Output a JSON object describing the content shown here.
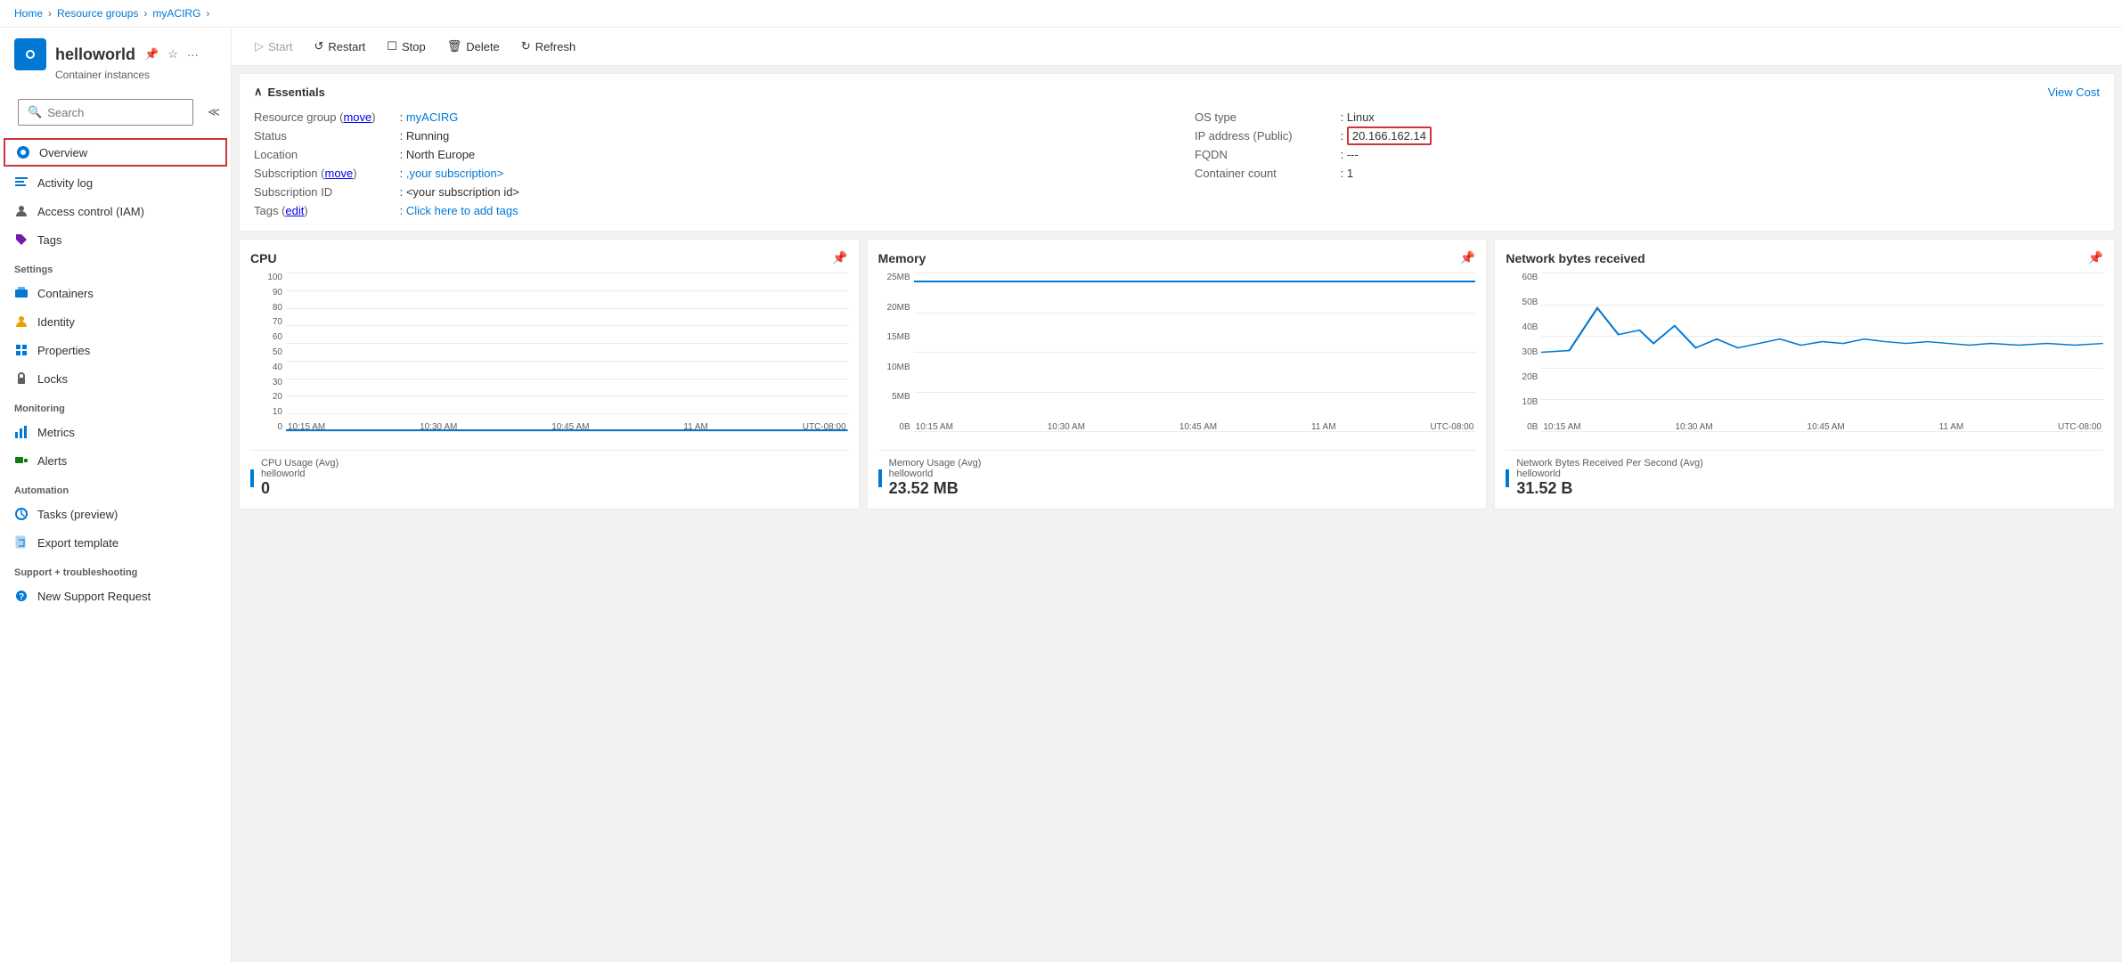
{
  "breadcrumb": {
    "home": "Home",
    "resourceGroups": "Resource groups",
    "myACIRG": "myACIRG"
  },
  "resource": {
    "name": "helloworld",
    "subtitle": "Container instances",
    "icon": "📦"
  },
  "search": {
    "placeholder": "Search"
  },
  "toolbar": {
    "start": "Start",
    "restart": "Restart",
    "stop": "Stop",
    "delete": "Delete",
    "refresh": "Refresh"
  },
  "essentials": {
    "title": "Essentials",
    "viewCost": "View Cost",
    "resourceGroupLabel": "Resource group (move)",
    "resourceGroupValue": "myACIRG",
    "statusLabel": "Status",
    "statusValue": "Running",
    "locationLabel": "Location",
    "locationValue": "North Europe",
    "subscriptionLabel": "Subscription (move)",
    "subscriptionValue": ",your subscription>",
    "subscriptionIdLabel": "Subscription ID",
    "subscriptionIdValue": "<your subscription id>",
    "tagsLabel": "Tags (edit)",
    "tagsValue": "Click here to add tags",
    "osTypeLabel": "OS type",
    "osTypeValue": "Linux",
    "ipAddressLabel": "IP address (Public)",
    "ipAddressValue": "20.166.162.14",
    "fqdnLabel": "FQDN",
    "fqdnValue": "---",
    "containerCountLabel": "Container count",
    "containerCountValue": "1"
  },
  "sidebar": {
    "overview": "Overview",
    "activityLog": "Activity log",
    "accessControl": "Access control (IAM)",
    "tags": "Tags",
    "settingsLabel": "Settings",
    "containers": "Containers",
    "identity": "Identity",
    "properties": "Properties",
    "locks": "Locks",
    "monitoringLabel": "Monitoring",
    "metrics": "Metrics",
    "alerts": "Alerts",
    "automationLabel": "Automation",
    "tasks": "Tasks (preview)",
    "exportTemplate": "Export template",
    "supportLabel": "Support + troubleshooting",
    "newSupportRequest": "New Support Request"
  },
  "charts": {
    "cpu": {
      "title": "CPU",
      "yLabels": [
        "100",
        "90",
        "80",
        "70",
        "60",
        "50",
        "40",
        "30",
        "20",
        "10",
        "0"
      ],
      "xLabels": [
        "10:15 AM",
        "10:30 AM",
        "10:45 AM",
        "11 AM",
        "UTC-08:00"
      ],
      "legendLabel": "CPU Usage (Avg)",
      "legendSub": "helloworld",
      "value": "0"
    },
    "memory": {
      "title": "Memory",
      "yLabels": [
        "25MB",
        "20MB",
        "15MB",
        "10MB",
        "5MB",
        "0B"
      ],
      "xLabels": [
        "10:15 AM",
        "10:30 AM",
        "10:45 AM",
        "11 AM",
        "UTC-08:00"
      ],
      "legendLabel": "Memory Usage (Avg)",
      "legendSub": "helloworld",
      "value": "23.52 MB"
    },
    "network": {
      "title": "Network bytes received",
      "yLabels": [
        "60B",
        "50B",
        "40B",
        "30B",
        "20B",
        "10B",
        "0B"
      ],
      "xLabels": [
        "10:15 AM",
        "10:30 AM",
        "10:45 AM",
        "11 AM",
        "UTC-08:00"
      ],
      "legendLabel": "Network Bytes Received Per Second (Avg)",
      "legendSub": "helloworld",
      "value": "31.52 B"
    }
  }
}
